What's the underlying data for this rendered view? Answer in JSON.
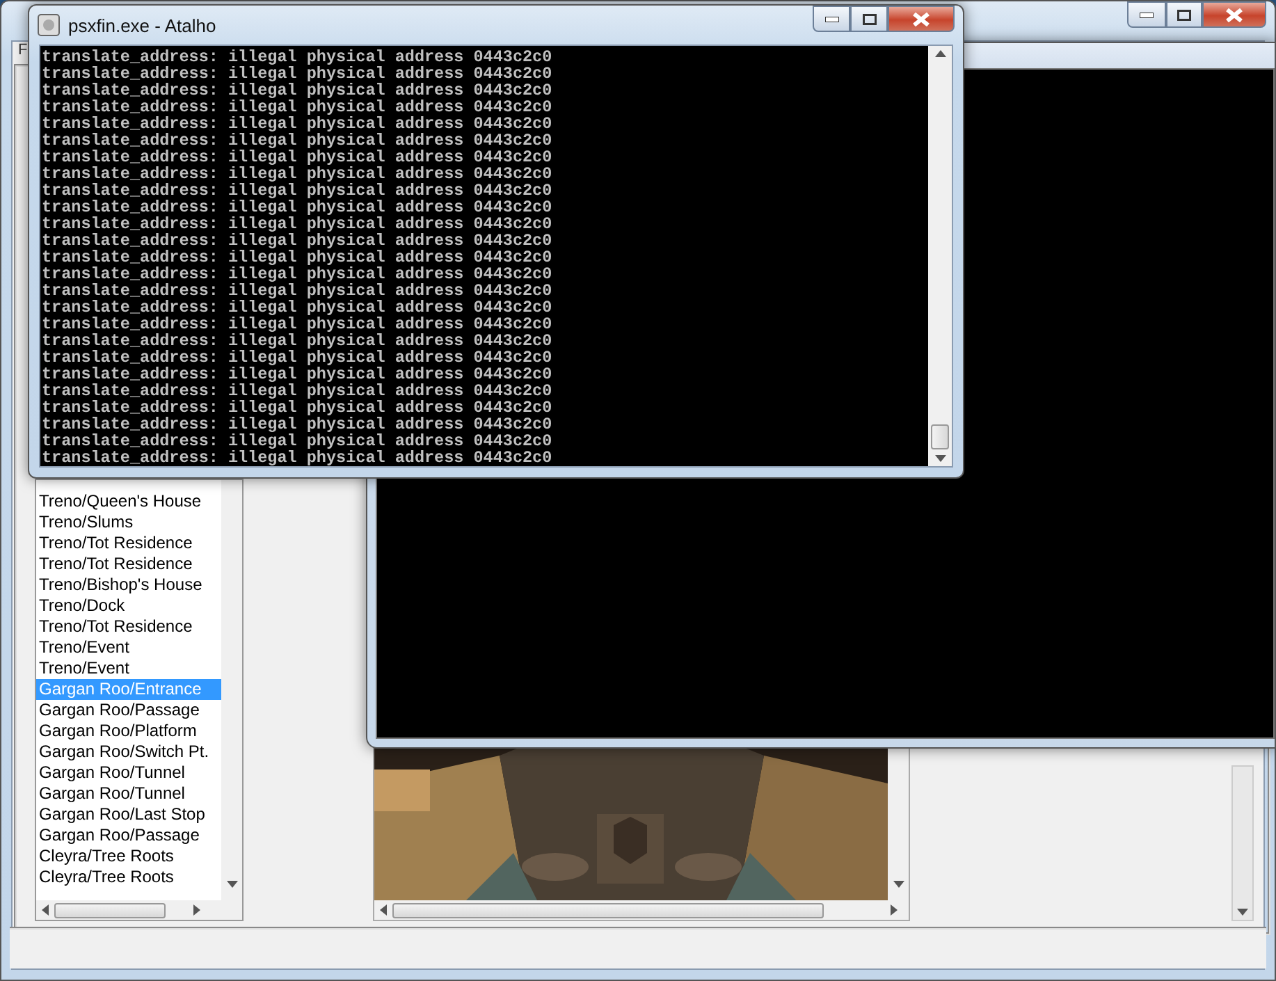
{
  "main_window": {
    "menu": [
      "F"
    ],
    "locations": [
      {
        "label": "Treno/Queen's House",
        "selected": false
      },
      {
        "label": "Treno/Slums",
        "selected": false
      },
      {
        "label": "Treno/Tot Residence",
        "selected": false
      },
      {
        "label": "Treno/Tot Residence",
        "selected": false
      },
      {
        "label": "Treno/Bishop's House",
        "selected": false
      },
      {
        "label": "Treno/Dock",
        "selected": false
      },
      {
        "label": "Treno/Tot Residence",
        "selected": false
      },
      {
        "label": "Treno/Event",
        "selected": false
      },
      {
        "label": "Treno/Event",
        "selected": false
      },
      {
        "label": "Gargan Roo/Entrance",
        "selected": true
      },
      {
        "label": "Gargan Roo/Passage",
        "selected": false
      },
      {
        "label": "Gargan Roo/Platform",
        "selected": false
      },
      {
        "label": "Gargan Roo/Switch Pt.",
        "selected": false
      },
      {
        "label": "Gargan Roo/Tunnel",
        "selected": false
      },
      {
        "label": "Gargan Roo/Tunnel",
        "selected": false
      },
      {
        "label": "Gargan Roo/Last Stop",
        "selected": false
      },
      {
        "label": "Gargan Roo/Passage",
        "selected": false
      },
      {
        "label": "Cleyra/Tree Roots",
        "selected": false
      },
      {
        "label": "Cleyra/Tree Roots",
        "selected": false
      }
    ]
  },
  "console_window": {
    "title": "psxfin.exe - Atalho",
    "lines": [
      "translate_address: illegal physical address 0443c2c0",
      "translate_address: illegal physical address 0443c2c0",
      "translate_address: illegal physical address 0443c2c0",
      "translate_address: illegal physical address 0443c2c0",
      "translate_address: illegal physical address 0443c2c0",
      "translate_address: illegal physical address 0443c2c0",
      "translate_address: illegal physical address 0443c2c0",
      "translate_address: illegal physical address 0443c2c0",
      "translate_address: illegal physical address 0443c2c0",
      "translate_address: illegal physical address 0443c2c0",
      "translate_address: illegal physical address 0443c2c0",
      "translate_address: illegal physical address 0443c2c0",
      "translate_address: illegal physical address 0443c2c0",
      "translate_address: illegal physical address 0443c2c0",
      "translate_address: illegal physical address 0443c2c0",
      "translate_address: illegal physical address 0443c2c0",
      "translate_address: illegal physical address 0443c2c0",
      "translate_address: illegal physical address 0443c2c0",
      "translate_address: illegal physical address 0443c2c0",
      "translate_address: illegal physical address 0443c2c0",
      "translate_address: illegal physical address 0443c2c0",
      "translate_address: illegal physical address 0443c2c0",
      "translate_address: illegal physical address 0443c2c0",
      "translate_address: illegal physical address 0443c2c0",
      "translate_address: illegal physical address 0443c2c0"
    ]
  }
}
